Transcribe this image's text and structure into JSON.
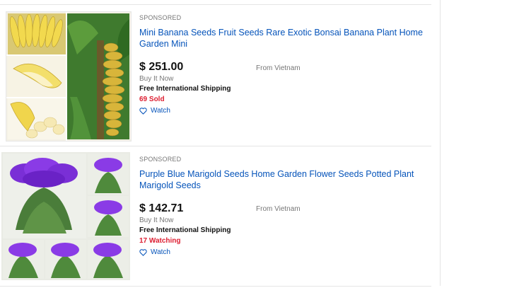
{
  "results": [
    {
      "sponsored_label": "SPONSORED",
      "title": "Mini Banana Seeds Fruit Seeds Rare Exotic Bonsai Banana Plant Home Garden Mini",
      "price": "$ 251.00",
      "format": "Buy It Now",
      "shipping": "Free International Shipping",
      "status": "69 Sold",
      "watch_label": "Watch",
      "location": "From Vietnam",
      "image_subject": "banana-plant-collage"
    },
    {
      "sponsored_label": "SPONSORED",
      "title": "Purple Blue Marigold Seeds Home Garden Flower Seeds Potted Plant Marigold Seeds",
      "price": "$ 142.71",
      "format": "Buy It Now",
      "shipping": "Free International Shipping",
      "status": "17 Watching",
      "watch_label": "Watch",
      "location": "From Vietnam",
      "image_subject": "purple-marigold-collage"
    }
  ],
  "colors": {
    "link": "#0654ba",
    "status_red": "#dd1e31",
    "muted": "#767676"
  },
  "icons": {
    "watch": "heart-icon"
  }
}
